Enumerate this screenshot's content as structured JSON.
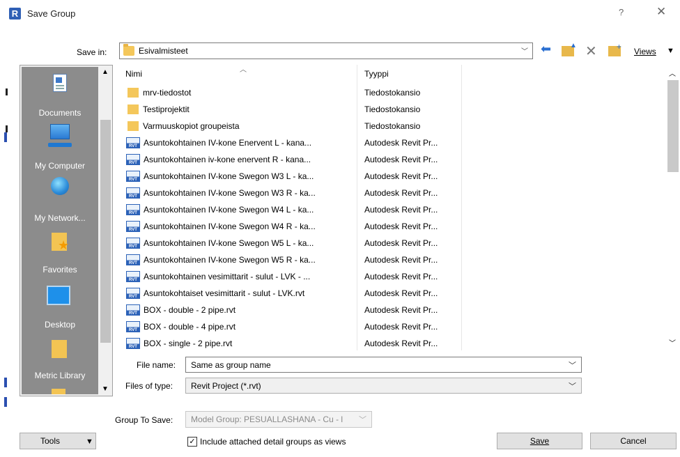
{
  "window": {
    "title": "Save Group",
    "app_icon_letter": "R",
    "help_glyph": "?",
    "close_glyph": "✕"
  },
  "save_in": {
    "label": "Save in:",
    "value": "Esivalmisteet"
  },
  "toolbar": {
    "views_label": "Views"
  },
  "places": [
    {
      "label": "Documents",
      "icon": "documents-icon"
    },
    {
      "label": "My Computer",
      "icon": "computer-icon"
    },
    {
      "label": "My Network...",
      "icon": "network-icon"
    },
    {
      "label": "Favorites",
      "icon": "favorites-icon"
    },
    {
      "label": "Desktop",
      "icon": "desktop-icon"
    },
    {
      "label": "Metric Library",
      "icon": "folder-icon"
    }
  ],
  "file_list": {
    "columns": {
      "name": "Nimi",
      "type": "Tyyppi"
    },
    "rows": [
      {
        "name": "mrv-tiedostot",
        "type": "Tiedostokansio",
        "kind": "folder"
      },
      {
        "name": "Testiprojektit",
        "type": "Tiedostokansio",
        "kind": "folder"
      },
      {
        "name": "Varmuuskopiot groupeista",
        "type": "Tiedostokansio",
        "kind": "folder"
      },
      {
        "name": "Asuntokohtainen IV-kone Enervent L - kana...",
        "type": "Autodesk Revit Pr...",
        "kind": "rvt"
      },
      {
        "name": "Asuntokohtainen iv-kone enervent R - kana...",
        "type": "Autodesk Revit Pr...",
        "kind": "rvt"
      },
      {
        "name": "Asuntokohtainen IV-kone Swegon W3 L - ka...",
        "type": "Autodesk Revit Pr...",
        "kind": "rvt"
      },
      {
        "name": "Asuntokohtainen IV-kone Swegon W3 R - ka...",
        "type": "Autodesk Revit Pr...",
        "kind": "rvt"
      },
      {
        "name": "Asuntokohtainen IV-kone Swegon W4 L - ka...",
        "type": "Autodesk Revit Pr...",
        "kind": "rvt"
      },
      {
        "name": "Asuntokohtainen IV-kone Swegon W4 R - ka...",
        "type": "Autodesk Revit Pr...",
        "kind": "rvt"
      },
      {
        "name": "Asuntokohtainen IV-kone Swegon W5 L - ka...",
        "type": "Autodesk Revit Pr...",
        "kind": "rvt"
      },
      {
        "name": "Asuntokohtainen IV-kone Swegon W5 R - ka...",
        "type": "Autodesk Revit Pr...",
        "kind": "rvt"
      },
      {
        "name": "Asuntokohtainen vesimittarit - sulut - LVK - ...",
        "type": "Autodesk Revit Pr...",
        "kind": "rvt"
      },
      {
        "name": "Asuntokohtaiset vesimittarit - sulut - LVK.rvt",
        "type": "Autodesk Revit Pr...",
        "kind": "rvt"
      },
      {
        "name": "BOX - double - 2 pipe.rvt",
        "type": "Autodesk Revit Pr...",
        "kind": "rvt"
      },
      {
        "name": "BOX - double - 4 pipe.rvt",
        "type": "Autodesk Revit Pr...",
        "kind": "rvt"
      },
      {
        "name": "BOX - single - 2 pipe.rvt",
        "type": "Autodesk Revit Pr...",
        "kind": "rvt"
      }
    ]
  },
  "form": {
    "file_name_label": "File name:",
    "file_name_value": "Same as group name",
    "files_of_type_label": "Files of type:",
    "files_of_type_value": "Revit Project  (*.rvt)",
    "group_to_save_label": "Group To Save:",
    "group_to_save_value": "Model Group: PESUALLASHANA - Cu - l",
    "include_detail_label": "Include attached detail groups as views",
    "include_detail_checked": true
  },
  "buttons": {
    "tools": "Tools",
    "save": "Save",
    "cancel": "Cancel"
  },
  "rvt_icon_text": "RVT"
}
